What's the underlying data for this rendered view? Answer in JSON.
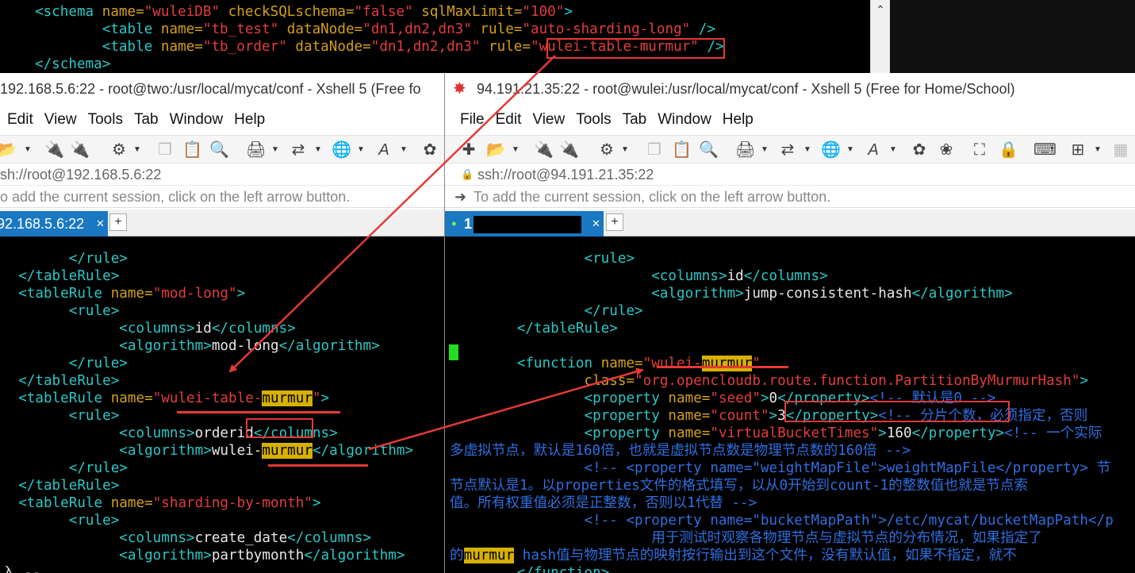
{
  "top_terminal": {
    "lines": [
      {
        "parts": [
          [
            "tag",
            "<schema "
          ],
          [
            "attr",
            "name="
          ],
          [
            "str",
            "\"wuleiDB\""
          ],
          [
            "attr",
            " checkSQLschema="
          ],
          [
            "str",
            "\"false\""
          ],
          [
            "attr",
            " sqlMaxLimit="
          ],
          [
            "str",
            "\"100\""
          ],
          [
            "tag",
            ">"
          ]
        ]
      },
      {
        "parts": [
          [
            "tag",
            "        <table "
          ],
          [
            "attr",
            "name="
          ],
          [
            "str",
            "\"tb_test\""
          ],
          [
            "attr",
            " dataNode="
          ],
          [
            "str",
            "\"dn1,dn2,dn3\""
          ],
          [
            "attr",
            " rule="
          ],
          [
            "str",
            "\"auto-sharding-long\""
          ],
          [
            "tag",
            " />"
          ]
        ]
      },
      {
        "parts": [
          [
            "tag",
            "        <table "
          ],
          [
            "attr",
            "name="
          ],
          [
            "str",
            "\"tb_order\""
          ],
          [
            "attr",
            " dataNode="
          ],
          [
            "str",
            "\"dn1,dn2,dn3\""
          ],
          [
            "attr",
            " rule="
          ],
          [
            "str",
            "\"wulei-table-murmur\""
          ],
          [
            "tag",
            " />"
          ]
        ]
      },
      {
        "parts": [
          [
            "tag",
            "</schema>"
          ]
        ]
      }
    ]
  },
  "left_window": {
    "title": "192.168.5.6:22 - root@two:/usr/local/mycat/conf - Xshell 5 (Free fo",
    "menu": [
      "Edit",
      "View",
      "Tools",
      "Tab",
      "Window",
      "Help"
    ],
    "address": "sh://root@192.168.5.6:22",
    "hint": "o add the current session, click on the left arrow button.",
    "tab_label": "92.168.5.6:22",
    "terminal_lines": [
      {
        "indent": "        ",
        "parts": [
          [
            "tag",
            "</rule>"
          ]
        ]
      },
      {
        "indent": "  ",
        "parts": [
          [
            "tag",
            "</tableRule>"
          ]
        ]
      },
      {
        "indent": "  ",
        "parts": [
          [
            "tag",
            "<tableRule "
          ],
          [
            "attr",
            "name="
          ],
          [
            "str",
            "\"mod-long\""
          ],
          [
            "tag",
            ">"
          ]
        ]
      },
      {
        "indent": "        ",
        "parts": [
          [
            "tag",
            "<rule>"
          ]
        ]
      },
      {
        "indent": "              ",
        "parts": [
          [
            "tag",
            "<columns>"
          ],
          [
            "txt",
            "id"
          ],
          [
            "tag",
            "</columns>"
          ]
        ]
      },
      {
        "indent": "              ",
        "parts": [
          [
            "tag",
            "<algorithm>"
          ],
          [
            "txt",
            "mod-long"
          ],
          [
            "tag",
            "</algorithm>"
          ]
        ]
      },
      {
        "indent": "        ",
        "parts": [
          [
            "tag",
            "</rule>"
          ]
        ]
      },
      {
        "indent": "  ",
        "parts": [
          [
            "tag",
            "</tableRule>"
          ]
        ]
      },
      {
        "indent": "  ",
        "parts": [
          [
            "tag",
            "<tableRule "
          ],
          [
            "attr",
            "name="
          ],
          [
            "str",
            "\"wulei-table-"
          ],
          [
            "hl",
            "murmur"
          ],
          [
            "str",
            "\""
          ],
          [
            "tag",
            ">"
          ]
        ]
      },
      {
        "indent": "        ",
        "parts": [
          [
            "tag",
            "<rule>"
          ]
        ]
      },
      {
        "indent": "              ",
        "parts": [
          [
            "tag",
            "<columns>"
          ],
          [
            "txt",
            "orderid"
          ],
          [
            "tag",
            "</columns>"
          ]
        ]
      },
      {
        "indent": "              ",
        "parts": [
          [
            "tag",
            "<algorithm>"
          ],
          [
            "txt",
            "wulei-"
          ],
          [
            "hl",
            "murmur"
          ],
          [
            "tag",
            "</algorithm>"
          ]
        ]
      },
      {
        "indent": "        ",
        "parts": [
          [
            "tag",
            "</rule>"
          ]
        ]
      },
      {
        "indent": "  ",
        "parts": [
          [
            "tag",
            "</tableRule>"
          ]
        ]
      },
      {
        "indent": "  ",
        "parts": [
          [
            "tag",
            "<tableRule "
          ],
          [
            "attr",
            "name="
          ],
          [
            "str",
            "\"sharding-by-month\""
          ],
          [
            "tag",
            ">"
          ]
        ]
      },
      {
        "indent": "        ",
        "parts": [
          [
            "tag",
            "<rule>"
          ]
        ]
      },
      {
        "indent": "              ",
        "parts": [
          [
            "tag",
            "<columns>"
          ],
          [
            "txt",
            "create_date"
          ],
          [
            "tag",
            "</columns>"
          ]
        ]
      },
      {
        "indent": "              ",
        "parts": [
          [
            "tag",
            "<algorithm>"
          ],
          [
            "txt",
            "partbymonth"
          ],
          [
            "tag",
            "</algorithm>"
          ]
        ]
      },
      {
        "indent": "",
        "parts": [
          [
            "txt",
            "入 --"
          ]
        ]
      }
    ]
  },
  "right_window": {
    "title": "94.191.21.35:22 - root@wulei:/usr/local/mycat/conf - Xshell 5 (Free for Home/School)",
    "menu": [
      "File",
      "Edit",
      "View",
      "Tools",
      "Tab",
      "Window",
      "Help"
    ],
    "address": "ssh://root@94.191.21.35:22",
    "hint": "To add the current session, click on the left arrow button.",
    "tab_label": "1",
    "terminal_lines": [
      {
        "indent": "                ",
        "parts": [
          [
            "tag",
            "<rule>"
          ]
        ]
      },
      {
        "indent": "                        ",
        "parts": [
          [
            "tag",
            "<columns>"
          ],
          [
            "txt",
            "id"
          ],
          [
            "tag",
            "</columns>"
          ]
        ]
      },
      {
        "indent": "                        ",
        "parts": [
          [
            "tag",
            "<algorithm>"
          ],
          [
            "txt",
            "jump-consistent-hash"
          ],
          [
            "tag",
            "</algorithm>"
          ]
        ]
      },
      {
        "indent": "                ",
        "parts": [
          [
            "tag",
            "</rule>"
          ]
        ]
      },
      {
        "indent": "        ",
        "parts": [
          [
            "tag",
            "</tableRule>"
          ]
        ]
      },
      {
        "indent": "",
        "parts": []
      },
      {
        "indent": "        ",
        "parts": [
          [
            "tag",
            "<function "
          ],
          [
            "attr",
            "name="
          ],
          [
            "str",
            "\"wulei-"
          ],
          [
            "hl",
            "murmur"
          ],
          [
            "str",
            "\""
          ]
        ]
      },
      {
        "indent": "                ",
        "parts": [
          [
            "attr",
            "class="
          ],
          [
            "str",
            "\"org.opencloudb.route.function.PartitionByMurmurHash\""
          ],
          [
            "tag",
            ">"
          ]
        ]
      },
      {
        "indent": "                ",
        "parts": [
          [
            "tag",
            "<property "
          ],
          [
            "attr",
            "name="
          ],
          [
            "str",
            "\"seed\""
          ],
          [
            "tag",
            ">"
          ],
          [
            "txt",
            "0"
          ],
          [
            "tag",
            "</property>"
          ],
          [
            "cmt",
            "<!-- 默认是0 -->"
          ]
        ]
      },
      {
        "indent": "                ",
        "parts": [
          [
            "tag",
            "<property "
          ],
          [
            "attr",
            "name="
          ],
          [
            "str",
            "\"count\""
          ],
          [
            "tag",
            ">"
          ],
          [
            "txt",
            "3"
          ],
          [
            "tag",
            "</property>"
          ],
          [
            "cmt",
            "<!-- 分片个数，必须指定，否则"
          ]
        ]
      },
      {
        "indent": "                ",
        "parts": [
          [
            "tag",
            "<property "
          ],
          [
            "attr",
            "name="
          ],
          [
            "str",
            "\"virtualBucketTimes\""
          ],
          [
            "tag",
            ">"
          ],
          [
            "txt",
            "160"
          ],
          [
            "tag",
            "</property>"
          ],
          [
            "cmt",
            "<!-- 一个实际"
          ]
        ]
      },
      {
        "indent": "",
        "parts": [
          [
            "cmt",
            "多虚拟节点，默认是160倍，也就是虚拟节点数是物理节点数的160倍 -->"
          ]
        ]
      },
      {
        "indent": "                ",
        "parts": [
          [
            "cmt",
            "<!-- <property name=\"weightMapFile\">weightMapFile</property> 节"
          ]
        ]
      },
      {
        "indent": "",
        "parts": [
          [
            "cmt",
            "节点默认是1。以properties文件的格式填写，以从0开始到count-1的整数值也就是节点索"
          ]
        ]
      },
      {
        "indent": "",
        "parts": [
          [
            "cmt",
            "值。所有权重值必须是正整数，否则以1代替 -->"
          ]
        ]
      },
      {
        "indent": "                ",
        "parts": [
          [
            "cmt",
            "<!-- <property name=\"bucketMapPath\">/etc/mycat/bucketMapPath</p"
          ]
        ]
      },
      {
        "indent": "                        ",
        "parts": [
          [
            "cmt",
            "用于测试时观察各物理节点与虚拟节点的分布情况，如果指定了"
          ]
        ]
      },
      {
        "indent": "",
        "parts": [
          [
            "cmt",
            "的"
          ],
          [
            "hl",
            "murmur"
          ],
          [
            "cmt",
            " hash值与物理节点的映射按行输出到这个文件，没有默认值，如果不指定，就不"
          ]
        ]
      },
      {
        "indent": "        ",
        "parts": [
          [
            "tag",
            "</function>"
          ]
        ]
      }
    ]
  },
  "colors": {
    "annotation": "#e53935",
    "tab_active": "#1a78c2",
    "highlight": "#d7b100",
    "cursor": "#22dd22"
  }
}
